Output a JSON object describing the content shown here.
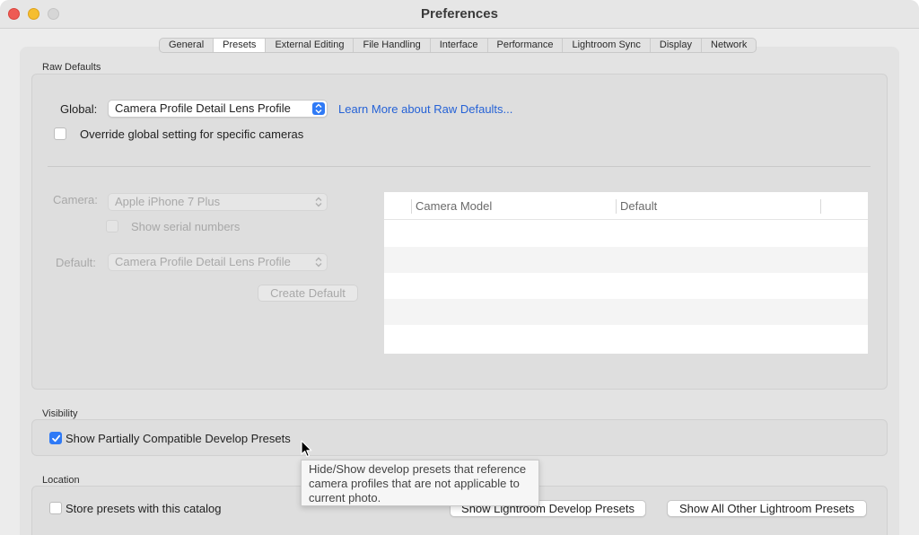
{
  "window": {
    "title": "Preferences"
  },
  "tabs": [
    {
      "label": "General"
    },
    {
      "label": "Presets"
    },
    {
      "label": "External Editing"
    },
    {
      "label": "File Handling"
    },
    {
      "label": "Interface"
    },
    {
      "label": "Performance"
    },
    {
      "label": "Lightroom Sync"
    },
    {
      "label": "Display"
    },
    {
      "label": "Network"
    }
  ],
  "active_tab": "Presets",
  "raw_defaults": {
    "section_label": "Raw Defaults",
    "global_label": "Global:",
    "global_value": "Camera Profile Detail Lens Profile",
    "learn_more_link": "Learn More about Raw Defaults...",
    "override_label": "Override global setting for specific cameras",
    "override_checked": false,
    "camera_label": "Camera:",
    "camera_value": "Apple iPhone 7 Plus",
    "serial_label": "Show serial numbers",
    "default_label": "Default:",
    "default_value": "Camera Profile Detail Lens Profile",
    "create_default_button": "Create Default",
    "table_headers": [
      "Camera Model",
      "Default"
    ]
  },
  "visibility": {
    "section_label": "Visibility",
    "partially_compatible_label": "Show Partially Compatible Develop Presets",
    "partially_compatible_checked": true
  },
  "tooltip": {
    "line1": "Hide/Show develop presets that reference",
    "line2": "camera profiles that are not applicable to",
    "line3": "current photo."
  },
  "location": {
    "section_label": "Location",
    "store_label": "Store presets with this catalog",
    "store_checked": false,
    "show_develop_button": "Show Lightroom Develop Presets",
    "show_other_button": "Show All Other Lightroom Presets"
  },
  "colors": {
    "accent": "#2f7af6",
    "link": "#2562d6",
    "close": "#ee5b54",
    "minimize": "#f5be2f"
  }
}
